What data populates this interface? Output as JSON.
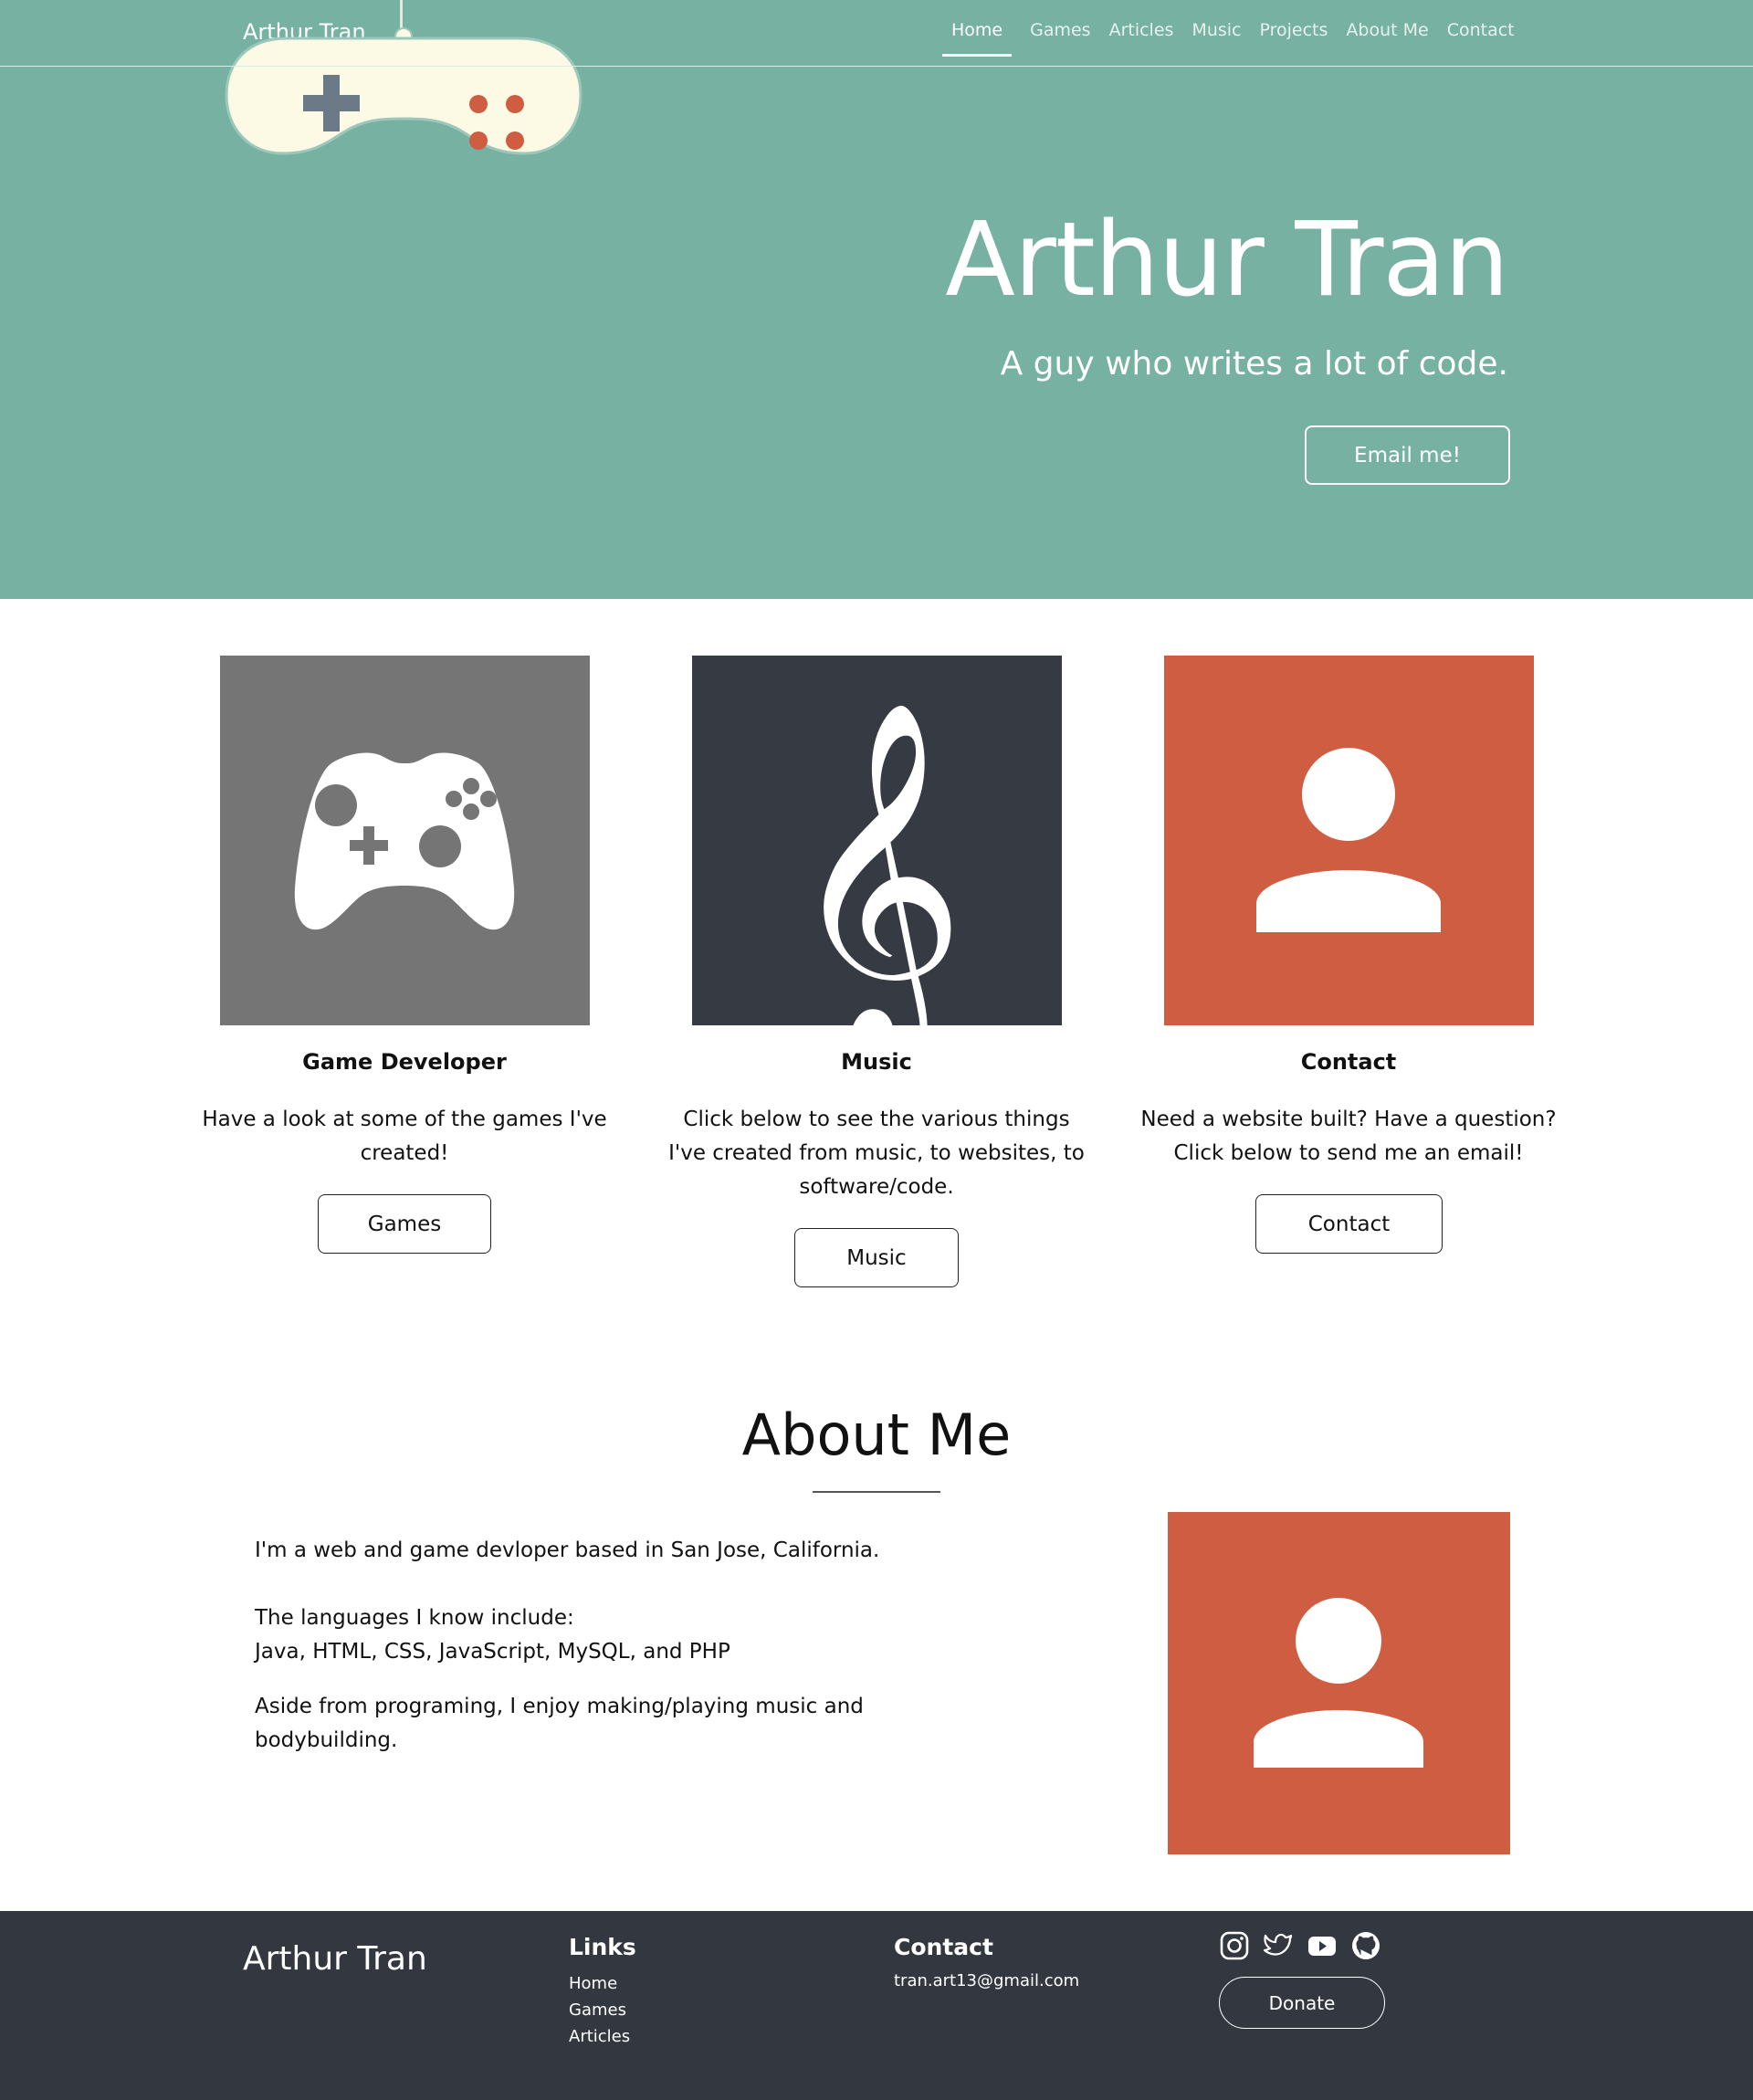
{
  "nav": {
    "brand": "Arthur Tran",
    "links": [
      "Home",
      "Games",
      "Articles",
      "Music",
      "Projects",
      "About Me",
      "Contact"
    ],
    "active": "Home"
  },
  "hero": {
    "title": "Arthur Tran",
    "subtitle": "A guy who writes a lot of code.",
    "button": "Email me!",
    "background_color": "#77b1a1",
    "decoration_icon": "gamepad-icon"
  },
  "cards": [
    {
      "icon": "game-controller-icon",
      "color": "#757575",
      "title": "Game Developer",
      "description": "Have a look at some of the games I've created!",
      "button": "Games"
    },
    {
      "icon": "treble-clef-icon",
      "color": "#363a42",
      "title": "Music",
      "description": "Click below to see the various things I've created from music, to websites, to software/code.",
      "button": "Music"
    },
    {
      "icon": "person-icon",
      "color": "#cf5d42",
      "title": "Contact",
      "description": "Need a website built? Have a question? Click below to send me an email!",
      "button": "Contact"
    }
  ],
  "about": {
    "title": "About Me",
    "paragraphs": [
      "I'm a web and game devloper based in San Jose, California.",
      "The languages I know include:",
      "Java, HTML, CSS, JavaScript, MySQL, and PHP",
      "Aside from programing, I enjoy making/playing music and bodybuilding."
    ],
    "image_icon": "person-icon",
    "image_color": "#cf5d42"
  },
  "footer": {
    "brand": "Arthur Tran",
    "links_heading": "Links",
    "links": [
      "Home",
      "Games",
      "Articles"
    ],
    "contact_heading": "Contact",
    "email": "tran.art13@gmail.com",
    "social_icons": [
      "instagram-icon",
      "twitter-icon",
      "youtube-icon",
      "github-icon"
    ],
    "donate": "Donate",
    "background_color": "#333840"
  }
}
